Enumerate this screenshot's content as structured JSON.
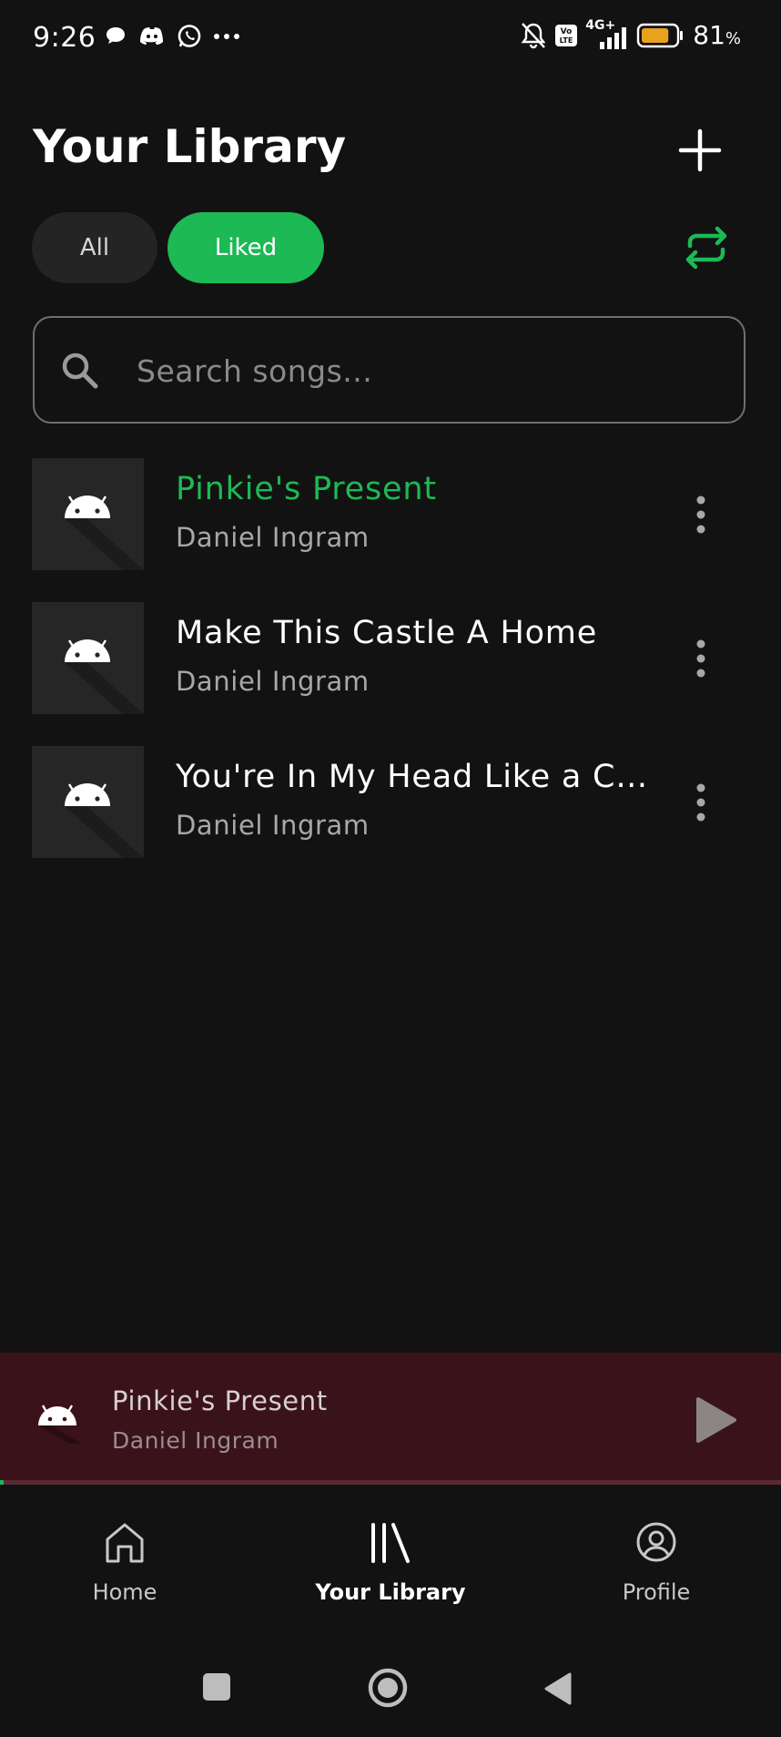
{
  "status_bar": {
    "time": "9:26",
    "network": "4G+",
    "volte": "Vo LTE",
    "battery_value": "81",
    "battery_unit": "%",
    "battery_level": 0.81,
    "battery_color": "#E8A21E"
  },
  "header": {
    "title": "Your Library"
  },
  "filters": {
    "all_label": "All",
    "liked_label": "Liked",
    "active": "Liked"
  },
  "search": {
    "placeholder": "Search songs..."
  },
  "songs": [
    {
      "title": "Pinkie's Present",
      "artist": "Daniel Ingram",
      "playing": true
    },
    {
      "title": "Make This Castle A Home",
      "artist": "Daniel Ingram",
      "playing": false
    },
    {
      "title": "You're In My Head Like a Catchy Song",
      "artist": "Daniel Ingram",
      "playing": false
    }
  ],
  "now_playing": {
    "title": "Pinkie's Present",
    "artist": "Daniel Ingram",
    "progress": 0.005
  },
  "bottom_nav": {
    "home": "Home",
    "library": "Your Library",
    "profile": "Profile",
    "active": "library"
  },
  "colors": {
    "accent": "#1DB954",
    "background": "#121212",
    "mini_player_bg": "#3A121A"
  }
}
